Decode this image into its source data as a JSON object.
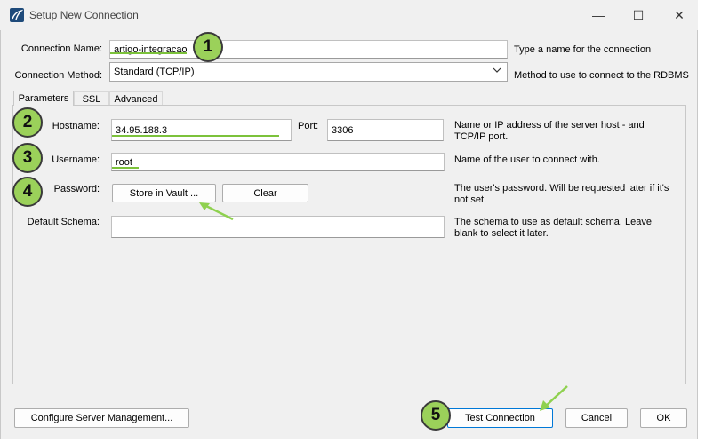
{
  "window": {
    "title": "Setup New Connection",
    "minimize": "—",
    "maximize": "☐",
    "close": "✕"
  },
  "connection": {
    "name_label": "Connection Name:",
    "name_value": "artigo-integracao",
    "name_help": "Type a name for the connection",
    "method_label": "Connection Method:",
    "method_value": "Standard (TCP/IP)",
    "method_help": "Method to use to connect to the RDBMS"
  },
  "tabs": [
    {
      "label": "Parameters",
      "active": true
    },
    {
      "label": "SSL",
      "active": false
    },
    {
      "label": "Advanced",
      "active": false
    }
  ],
  "params": {
    "hostname_label": "Hostname:",
    "hostname_value": "34.95.188.3",
    "port_label": "Port:",
    "port_value": "3306",
    "hostname_help": "Name or IP address of the server host - and TCP/IP port.",
    "username_label": "Username:",
    "username_value": "root",
    "username_help": "Name of the user to connect with.",
    "password_label": "Password:",
    "store_vault_label": "Store in Vault ...",
    "clear_label": "Clear",
    "password_help": "The user's password. Will be requested later if it's not set.",
    "schema_label": "Default Schema:",
    "schema_value": "",
    "schema_help": "The schema to use as default schema. Leave blank to select it later."
  },
  "footer": {
    "configure_label": "Configure Server Management...",
    "test_label": "Test Connection",
    "cancel_label": "Cancel",
    "ok_label": "OK"
  },
  "annotations": {
    "badges": [
      "1",
      "2",
      "3",
      "4",
      "5"
    ],
    "accent_color": "#9bd15a",
    "underline_color": "#7cc23b"
  }
}
